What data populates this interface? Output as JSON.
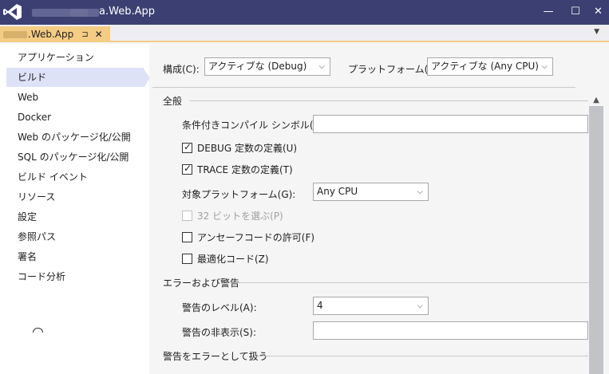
{
  "window": {
    "title": "a.Web.App",
    "minimize_glyph": "—",
    "maximize_glyph": "☐",
    "close_glyph": "✕"
  },
  "tab": {
    "label": ".Web.App",
    "pin_glyph": "⊐",
    "close_glyph": "✕",
    "dropdown_glyph": "▼"
  },
  "sidebar": {
    "items": [
      {
        "label": "アプリケーション"
      },
      {
        "label": "ビルド"
      },
      {
        "label": "Web"
      },
      {
        "label": "Docker"
      },
      {
        "label": "Web のパッケージ化/公開"
      },
      {
        "label": "SQL のパッケージ化/公開"
      },
      {
        "label": "ビルド イベント"
      },
      {
        "label": "リソース"
      },
      {
        "label": "設定"
      },
      {
        "label": "参照パス"
      },
      {
        "label": "署名"
      },
      {
        "label": "コード分析"
      }
    ],
    "selected_index": 1
  },
  "config": {
    "config_label": "構成(C):",
    "config_value": "アクティブな (Debug)",
    "platform_label": "プラットフォーム(M):",
    "platform_value": "アクティブな (Any CPU)"
  },
  "general": {
    "title": "全般",
    "symbols_label": "条件付きコンパイル シンボル(Y):",
    "symbols_value": "",
    "debug_label": "DEBUG 定数の定義(U)",
    "debug_checked": true,
    "trace_label": "TRACE 定数の定義(T)",
    "trace_checked": true,
    "platform_target_label": "対象プラットフォーム(G):",
    "platform_target_value": "Any CPU",
    "prefer32_label": "32 ビットを選ぶ(P)",
    "unsafe_label": "アンセーフコードの許可(F)",
    "optimize_label": "最適化コード(Z)"
  },
  "errors": {
    "title": "エラーおよび警告",
    "warning_level_label": "警告のレベル(A):",
    "warning_level_value": "4",
    "suppress_label": "警告の非表示(S):",
    "suppress_value": ""
  },
  "treat_warnings": {
    "title": "警告をエラーとして扱う"
  },
  "icons": {
    "check_glyph": "✓",
    "chevron_glyph": "⌵",
    "scroll_up_glyph": "▲"
  },
  "colors": {
    "titlebar": "#3b3f72",
    "tab_active": "#f5cc84",
    "sidebar_selected": "#dde2f7"
  }
}
